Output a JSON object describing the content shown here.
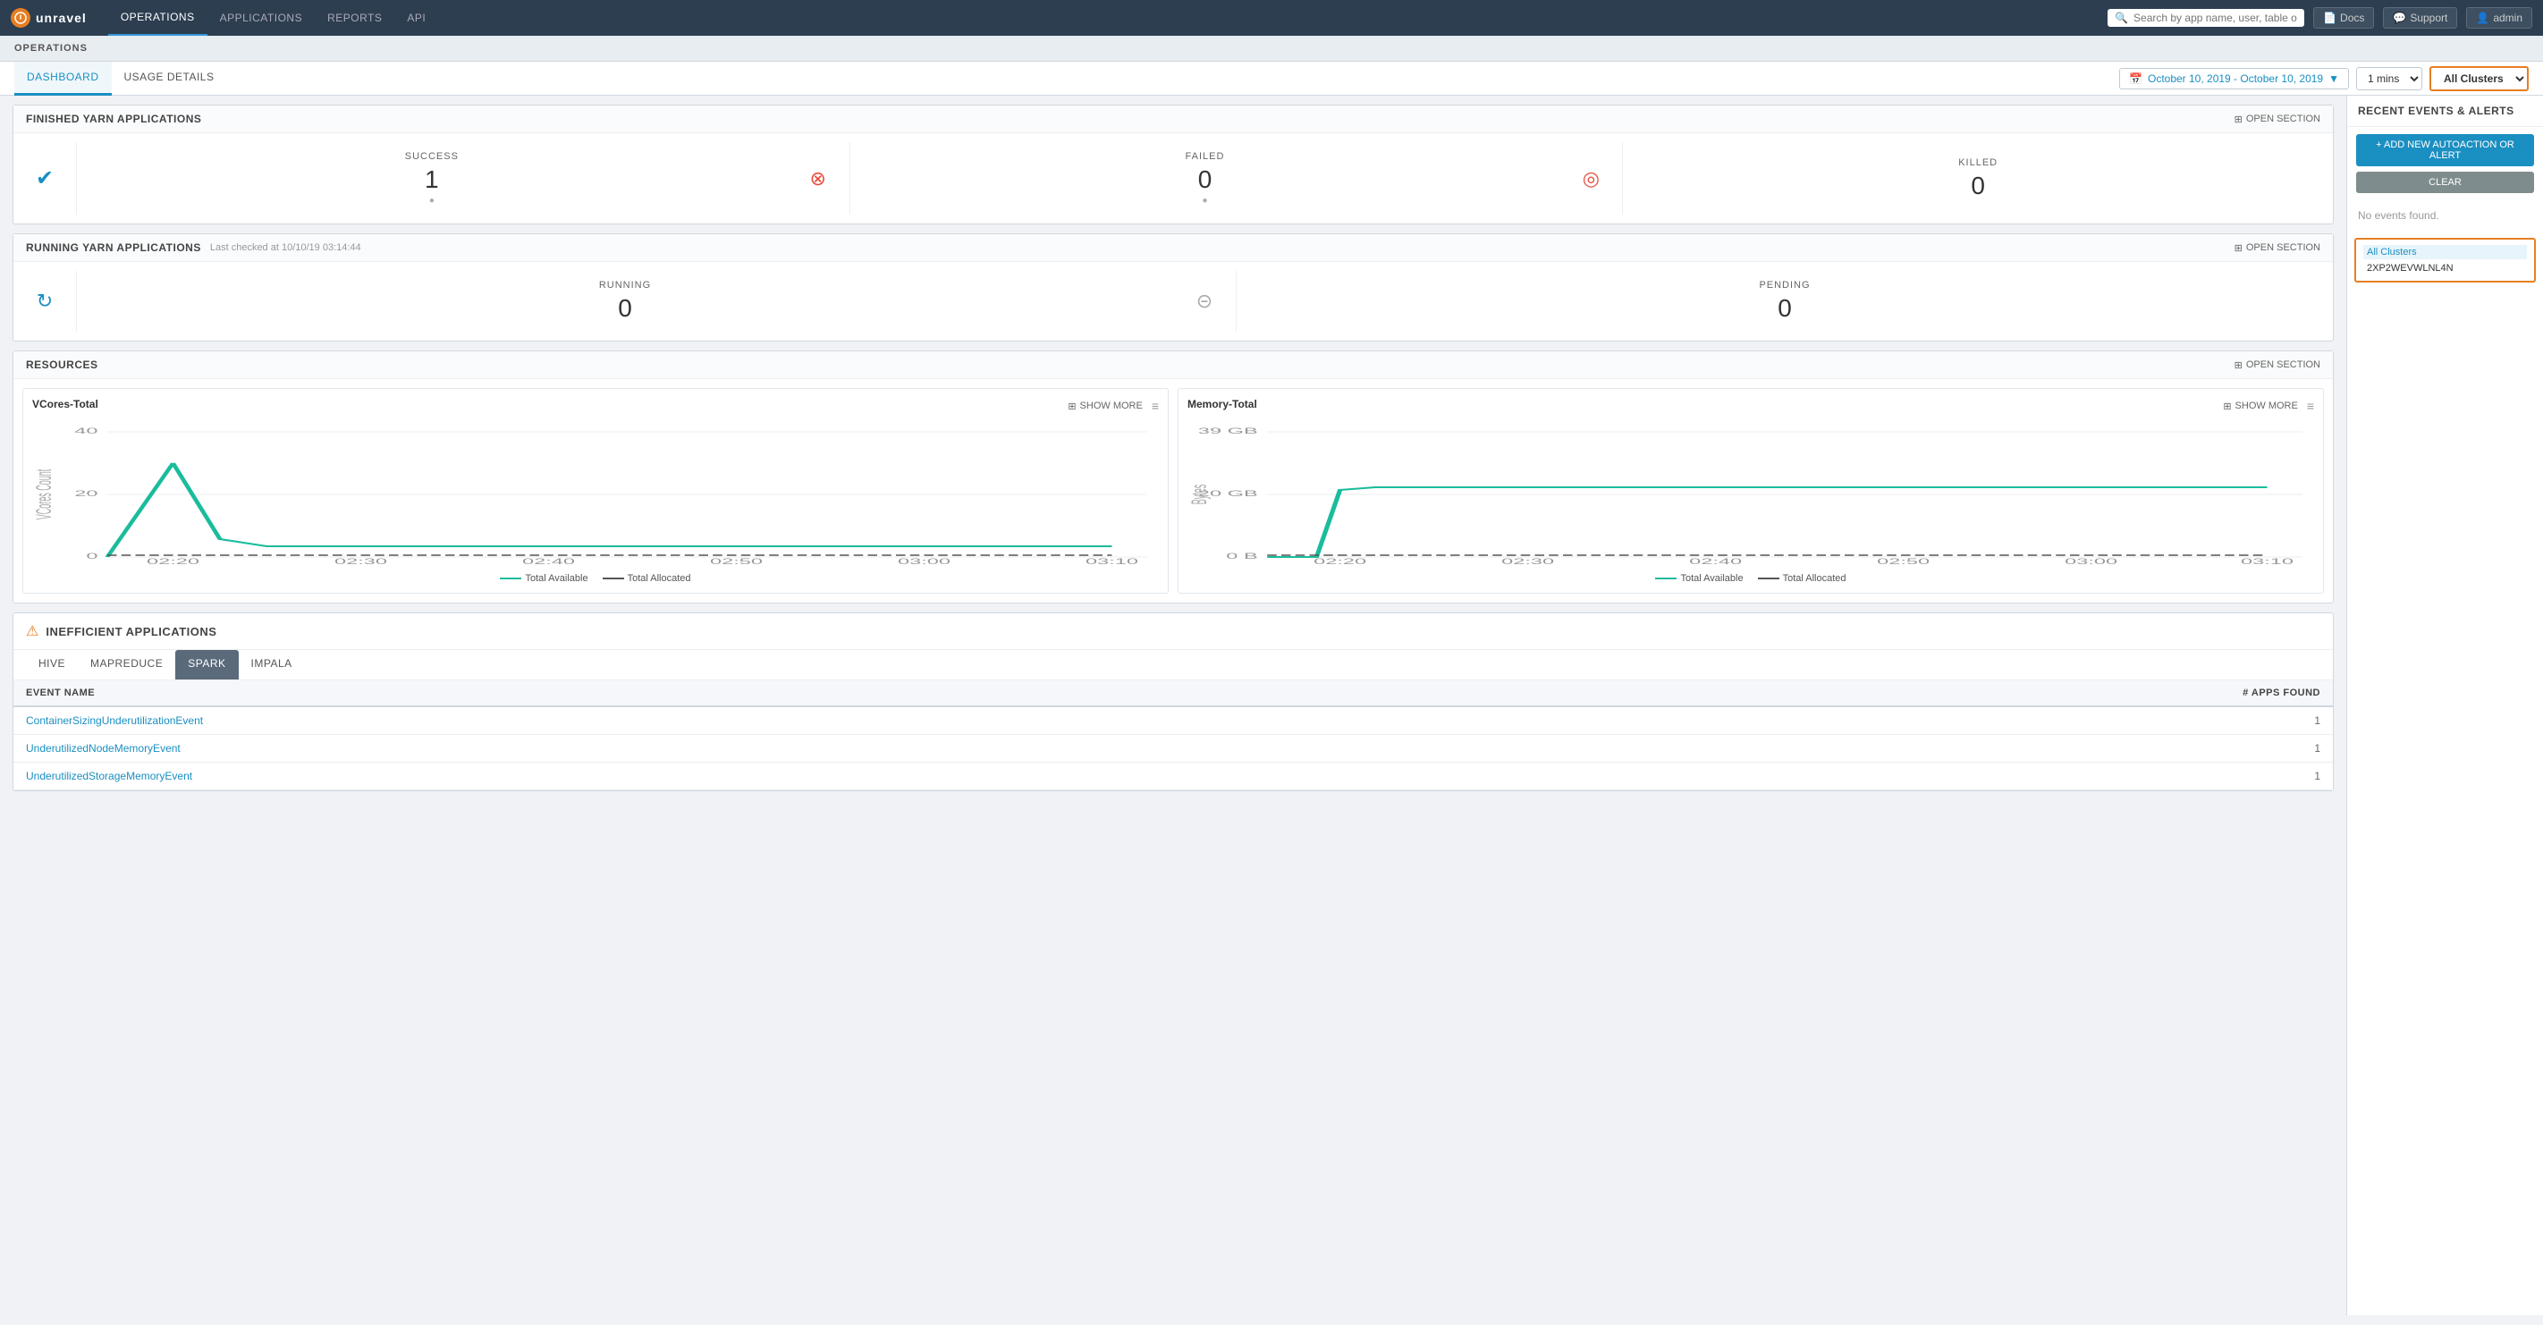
{
  "nav": {
    "logo_text": "unravel",
    "links": [
      "OPERATIONS",
      "APPLICATIONS",
      "REPORTS",
      "API"
    ],
    "active_link": "OPERATIONS",
    "search_placeholder": "Search by app name, user, table or clust",
    "docs_label": "Docs",
    "support_label": "Support",
    "admin_label": "admin"
  },
  "ops_bar": {
    "title": "OPERATIONS"
  },
  "sub_nav": {
    "items": [
      "DASHBOARD",
      "USAGE DETAILS"
    ],
    "active": "DASHBOARD",
    "date_range": "October 10, 2019 - October 10, 2019",
    "interval": "1 mins",
    "cluster": "All Clusters",
    "cluster_dropdown": "2XP2WEVWLNL4N"
  },
  "finished_yarn": {
    "section_title": "FINISHED YARN APPLICATIONS",
    "open_section_label": "OPEN SECTION",
    "metrics": [
      {
        "label": "SUCCESS",
        "value": "1",
        "sub": ""
      },
      {
        "label": "FAILED",
        "value": "0",
        "sub": ""
      },
      {
        "label": "KILLED",
        "value": "0",
        "sub": ""
      }
    ]
  },
  "running_yarn": {
    "section_title": "RUNNING YARN APPLICATIONS",
    "last_checked": "Last checked at 10/10/19 03:14:44",
    "open_section_label": "OPEN SECTION",
    "metrics": [
      {
        "label": "RUNNING",
        "value": "0"
      },
      {
        "label": "PENDING",
        "value": "0"
      }
    ]
  },
  "resources": {
    "section_title": "RESOURCES",
    "open_section_label": "OPEN SECTION",
    "vcores": {
      "title": "VCores-Total",
      "show_more": "SHOW MORE",
      "y_labels": [
        "40",
        "20",
        "0"
      ],
      "x_labels": [
        "02:20",
        "02:30",
        "02:40",
        "02:50",
        "03:00",
        "03:10"
      ],
      "y_axis_label": "VCores Count",
      "legend_available": "Total Available",
      "legend_allocated": "Total Allocated"
    },
    "memory": {
      "title": "Memory-Total",
      "show_more": "SHOW MORE",
      "y_labels": [
        "39 GB",
        "20 GB",
        "0 B"
      ],
      "x_labels": [
        "02:20",
        "02:30",
        "02:40",
        "02:50",
        "03:00",
        "03:10"
      ],
      "y_axis_label": "Bytes",
      "legend_available": "Total Available",
      "legend_allocated": "Total Allocated"
    }
  },
  "inefficient_apps": {
    "section_title": "INEFFICIENT APPLICATIONS",
    "tabs": [
      "HIVE",
      "MAPREDUCE",
      "SPARK",
      "IMPALA"
    ],
    "active_tab": "SPARK",
    "table": {
      "headers": [
        "EVENT NAME",
        "# APPS FOUND"
      ],
      "rows": [
        {
          "event": "ContainerSizingUnderutilizationEvent",
          "count": "1"
        },
        {
          "event": "UnderutilizedNodeMemoryEvent",
          "count": "1"
        },
        {
          "event": "UnderutilizedStorageMemoryEvent",
          "count": "1"
        }
      ]
    }
  },
  "sidebar": {
    "title": "RECENT EVENTS & ALERTS",
    "add_label": "+ ADD NEW AUTOACTION OR ALERT",
    "clear_label": "CLEAR",
    "no_events": "No events found."
  }
}
